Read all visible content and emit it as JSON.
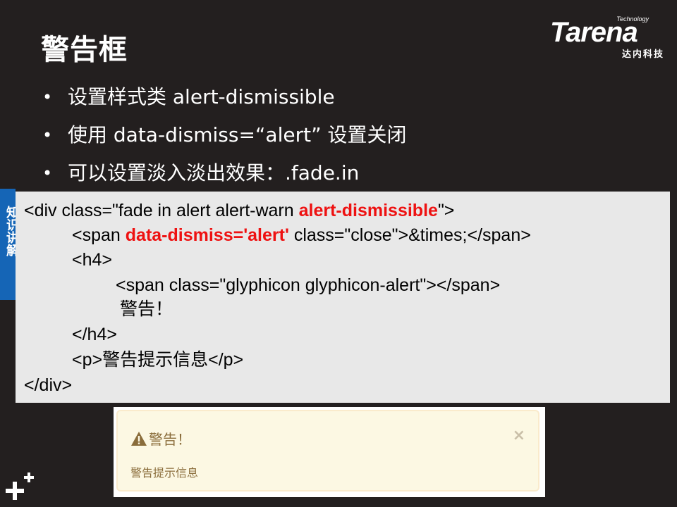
{
  "slide": {
    "title": "警告框",
    "logo": {
      "name": "Tarena",
      "tagline": "Technology",
      "sub": "达内科技"
    },
    "side_tab": "知识讲解",
    "bullets": [
      "设置样式类 alert-dismissible",
      "使用 data-dismiss=“alert”  设置关闭",
      "可以设置淡入淡出效果：.fade.in"
    ]
  },
  "code": {
    "l1_a": "<div class=\"fade in alert alert-warn ",
    "l1_b": "alert-dismissible",
    "l1_c": "\">",
    "l2_a": "<span ",
    "l2_b": "data-dismiss='alert'",
    "l2_c": " class=\"close\">&times;</span>",
    "l3": "<h4>",
    "l4": "<span class=\"glyphicon glyphicon-alert\"></span>",
    "l5": "警告！",
    "l6": "</h4>",
    "l7": "<p>警告提示信息</p>",
    "l8": "</div>"
  },
  "alert_demo": {
    "title": "警告！",
    "close": "×",
    "text": "警告提示信息"
  },
  "colors": {
    "background": "#231f1f",
    "highlight": "#ee1111",
    "side_tab": "#1565b6",
    "code_bg": "#e8e8e8"
  }
}
